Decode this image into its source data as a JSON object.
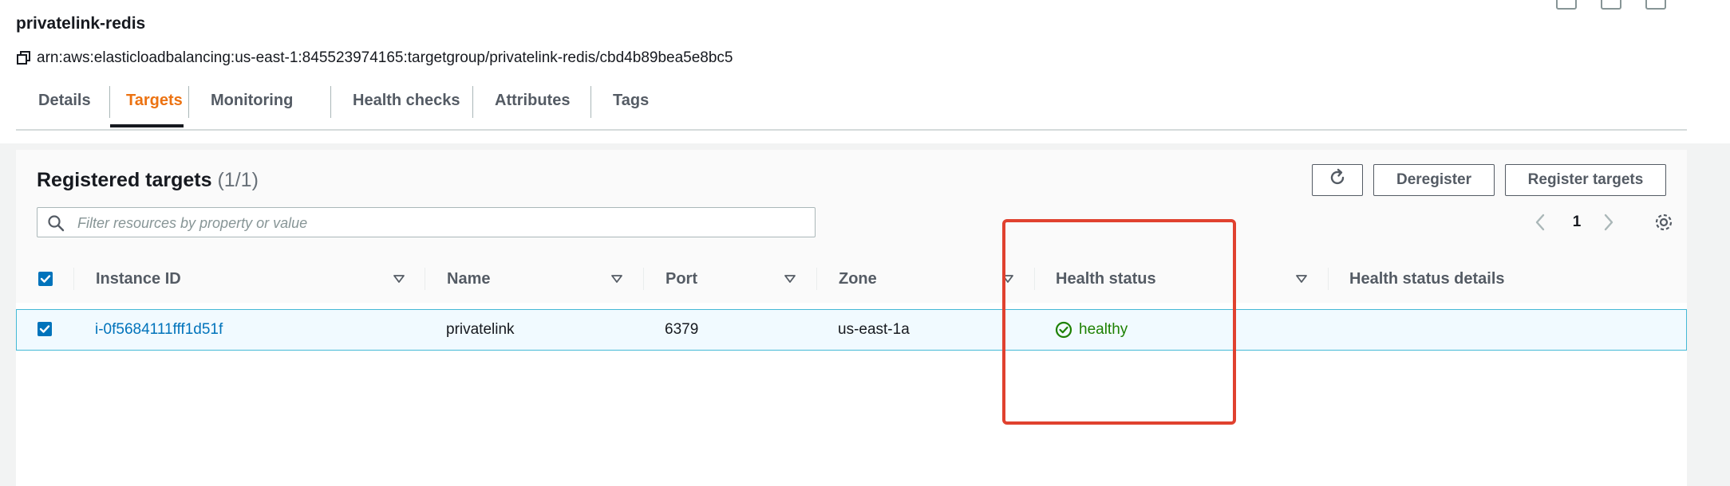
{
  "header": {
    "title": "privatelink-redis",
    "arn": "arn:aws:elasticloadbalancing:us-east-1:845523974165:targetgroup/privatelink-redis/cbd4b89bea5e8bc5"
  },
  "tabs": [
    {
      "label": "Details",
      "active": false
    },
    {
      "label": "Targets",
      "active": true
    },
    {
      "label": "Monitoring",
      "active": false
    },
    {
      "label": "Health checks",
      "active": false
    },
    {
      "label": "Attributes",
      "active": false
    },
    {
      "label": "Tags",
      "active": false
    }
  ],
  "panel": {
    "title": "Registered targets",
    "count": "(1/1)",
    "search_placeholder": "Filter resources by property or value",
    "buttons": {
      "deregister": "Deregister",
      "register": "Register targets"
    },
    "page": "1"
  },
  "table": {
    "columns": [
      "Instance ID",
      "Name",
      "Port",
      "Zone",
      "Health status",
      "Health status details"
    ],
    "rows": [
      {
        "selected": true,
        "instance_id": "i-0f5684111fff1d51f",
        "name": "privatelink",
        "port": "6379",
        "zone": "us-east-1a",
        "health_status": "healthy",
        "health_status_details": ""
      }
    ]
  },
  "colors": {
    "accent_tab": "#ec7211",
    "link": "#0073bb",
    "healthy": "#1d8102",
    "highlight": "#e0412f"
  },
  "icons": [
    "copy-icon",
    "refresh-icon",
    "search-icon",
    "chevron-left-icon",
    "chevron-right-icon",
    "gear-icon",
    "sort-icon",
    "check-circle-icon",
    "checkbox-icon"
  ]
}
